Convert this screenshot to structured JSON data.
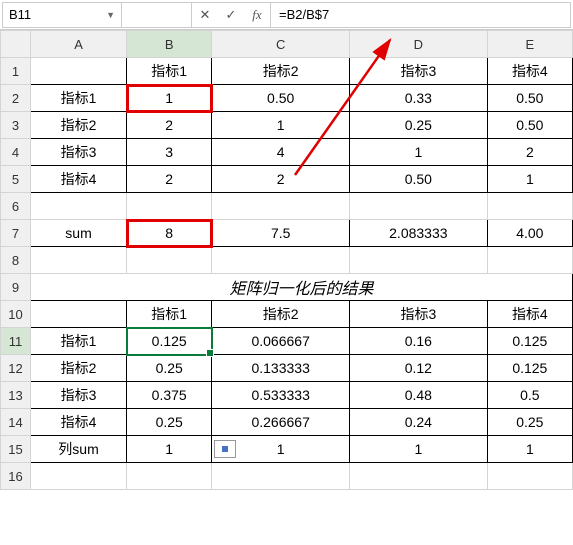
{
  "formula_bar": {
    "cell_ref": "B11",
    "formula": "=B2/B$7"
  },
  "col_headers": [
    "A",
    "B",
    "C",
    "D",
    "E"
  ],
  "row_headers": [
    "1",
    "2",
    "3",
    "4",
    "5",
    "6",
    "7",
    "8",
    "9",
    "10",
    "11",
    "12",
    "13",
    "14",
    "15",
    "16"
  ],
  "t1": {
    "h1": "指标1",
    "h2": "指标2",
    "h3": "指标3",
    "h4": "指标4",
    "r2a": "指标1",
    "r2b": "1",
    "r2c": "0.50",
    "r2d": "0.33",
    "r2e": "0.50",
    "r3a": "指标2",
    "r3b": "2",
    "r3c": "1",
    "r3d": "0.25",
    "r3e": "0.50",
    "r4a": "指标3",
    "r4b": "3",
    "r4c": "4",
    "r4d": "1",
    "r4e": "2",
    "r5a": "指标4",
    "r5b": "2",
    "r5c": "2",
    "r5d": "0.50",
    "r5e": "1"
  },
  "sum": {
    "label": "sum",
    "b": "8",
    "c": "7.5",
    "d": "2.083333",
    "e": "4.00"
  },
  "merged_title": "矩阵归一化后的结果",
  "t2": {
    "h1": "指标1",
    "h2": "指标2",
    "h3": "指标3",
    "h4": "指标4",
    "r11a": "指标1",
    "r11b": "0.125",
    "r11c": "0.066667",
    "r11d": "0.16",
    "r11e": "0.125",
    "r12a": "指标2",
    "r12b": "0.25",
    "r12c": "0.133333",
    "r12d": "0.12",
    "r12e": "0.125",
    "r13a": "指标3",
    "r13b": "0.375",
    "r13c": "0.533333",
    "r13d": "0.48",
    "r13e": "0.5",
    "r14a": "指标4",
    "r14b": "0.25",
    "r14c": "0.266667",
    "r14d": "0.24",
    "r14e": "0.25",
    "r15a": "列sum",
    "r15b": "1",
    "r15c": "1",
    "r15d": "1",
    "r15e": "1"
  },
  "chart_data": [
    {
      "type": "table",
      "title": "pairwise matrix",
      "columns": [
        "指标1",
        "指标2",
        "指标3",
        "指标4"
      ],
      "rows": [
        "指标1",
        "指标2",
        "指标3",
        "指标4"
      ],
      "values": [
        [
          1,
          0.5,
          0.33,
          0.5
        ],
        [
          2,
          1,
          0.25,
          0.5
        ],
        [
          3,
          4,
          1,
          2
        ],
        [
          2,
          2,
          0.5,
          1
        ]
      ],
      "sum": [
        8,
        7.5,
        2.083333,
        4.0
      ]
    },
    {
      "type": "table",
      "title": "矩阵归一化后的结果",
      "columns": [
        "指标1",
        "指标2",
        "指标3",
        "指标4"
      ],
      "rows": [
        "指标1",
        "指标2",
        "指标3",
        "指标4"
      ],
      "values": [
        [
          0.125,
          0.066667,
          0.16,
          0.125
        ],
        [
          0.25,
          0.133333,
          0.12,
          0.125
        ],
        [
          0.375,
          0.533333,
          0.48,
          0.5
        ],
        [
          0.25,
          0.266667,
          0.24,
          0.25
        ]
      ],
      "column_sum": [
        1,
        1,
        1,
        1
      ]
    }
  ]
}
